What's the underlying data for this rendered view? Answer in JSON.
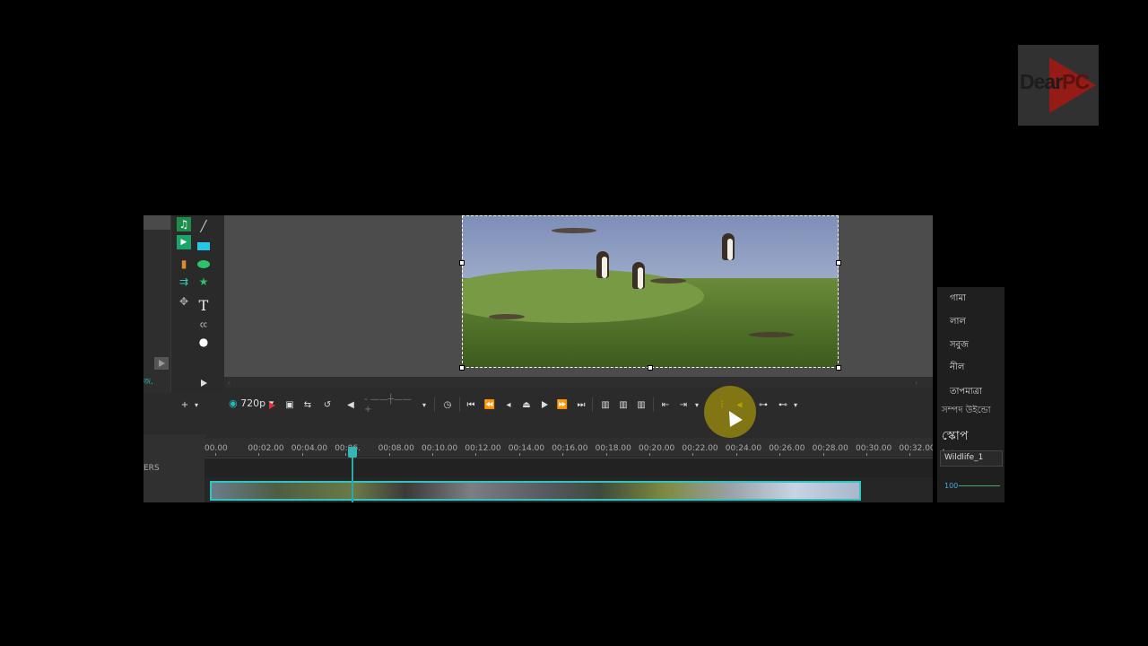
{
  "watermark": {
    "brand_text": "Dear",
    "brand_suffix": "PC"
  },
  "toolbar_left": {
    "tab_fragment": "জ."
  },
  "controls": {
    "resolution": "720p",
    "icons": [
      "eye-icon",
      "record-icon",
      "fit-icon",
      "loop-icon",
      "undo-icon",
      "volume-icon",
      "clock-icon",
      "skip-start-icon",
      "rewind-icon",
      "step-back-icon",
      "stop-icon",
      "play-icon",
      "fast-forward-icon",
      "skip-end-icon",
      "mark-in-icon",
      "mark-out-icon",
      "mark-clip-icon",
      "go-in-icon",
      "go-out-icon",
      "split-icon",
      "trim-icon",
      "link-icon",
      "unlink-icon"
    ]
  },
  "timeline": {
    "ticks": [
      "00.00",
      "00:02.00",
      "00:04.00",
      "00:06.",
      "00:08.00",
      "00:10.00",
      "00:12.00",
      "00:14.00",
      "00:16.00",
      "00:18.00",
      "00:20.00",
      "00:22.00",
      "00:24.00",
      "00:26.00",
      "00:28.00",
      "00:30.00",
      "00:32.00"
    ],
    "track_label": "ERS"
  },
  "color_panel": {
    "items": [
      "গামা",
      "লাল",
      "সবুজ",
      "নীল",
      "তাপমাত্রা"
    ],
    "header": "সম্পদ উইন্ডো",
    "big_label": "স্কোপ উইন্ডো",
    "field_value": "Wildlife_1",
    "scale_value": "100"
  },
  "colors": {
    "accent": "#33c3c3",
    "highlight": "#c8b400"
  }
}
